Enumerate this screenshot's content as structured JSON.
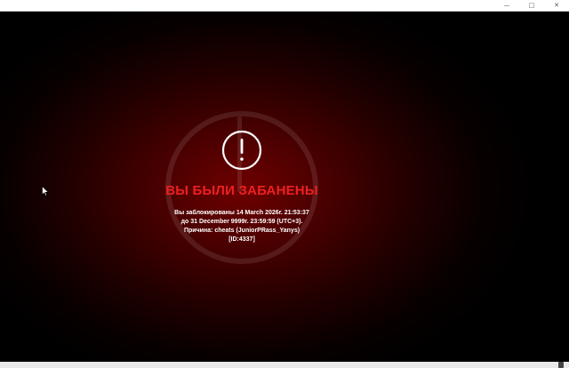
{
  "window": {
    "controls": {
      "minimize": "—",
      "maximize": "□",
      "close": "✕"
    }
  },
  "ban_screen": {
    "title": "ВЫ БЫЛИ ЗАБАНЕНЫ",
    "info_lines": [
      "Вы заблокированы 14 March 2026г. 21:53:37",
      "до 31 December 9999г. 23:59:59 (UTC+3).",
      "Причина: cheats (JuniorPRass_Yanys)",
      "[ID:4337]"
    ],
    "icon": "exclamation-circle-icon",
    "colors": {
      "title": "#ee2020",
      "background_center": "#6e0000",
      "text": "#ffffff"
    }
  }
}
